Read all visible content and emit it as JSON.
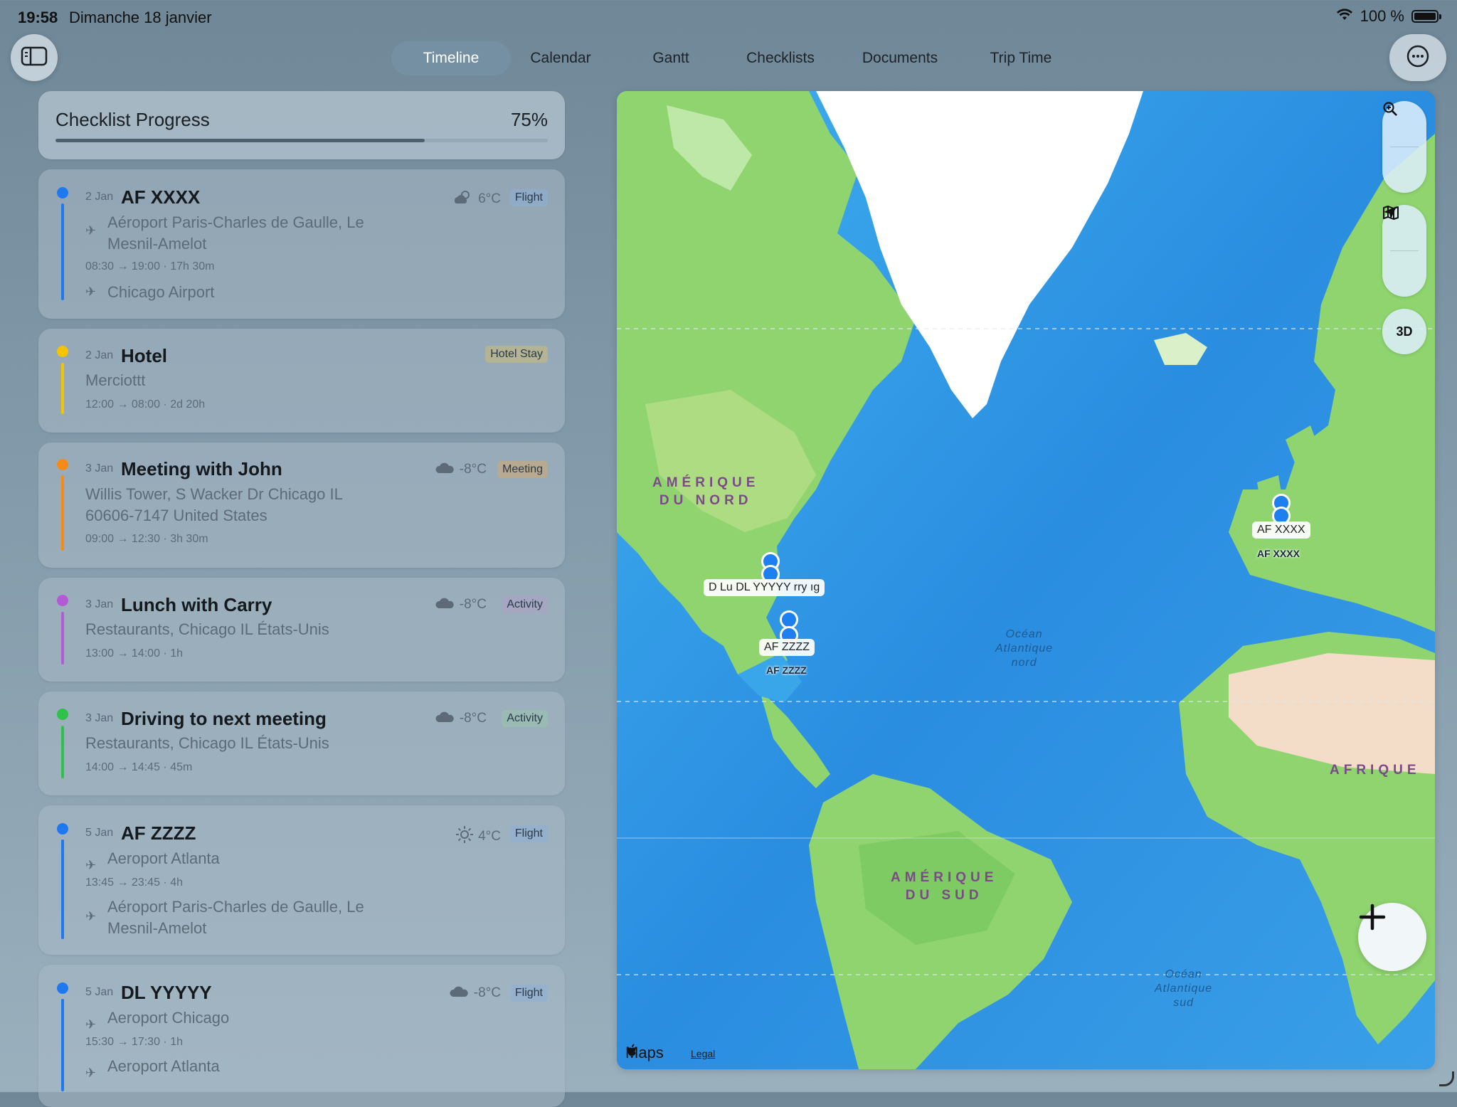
{
  "status_bar": {
    "time": "19:58",
    "date": "Dimanche 18 janvier",
    "battery": "100 %"
  },
  "tabs": [
    {
      "label": "Timeline",
      "active": true
    },
    {
      "label": "Calendar",
      "active": false
    },
    {
      "label": "Gantt",
      "active": false
    },
    {
      "label": "Checklists",
      "active": false
    },
    {
      "label": "Documents",
      "active": false
    },
    {
      "label": "Trip Time",
      "active": false
    }
  ],
  "checklist": {
    "title": "Checklist Progress",
    "percent_label": "75%",
    "progress": 0.75
  },
  "events": [
    {
      "date": "2 Jan",
      "title": "AF XXXX",
      "weather_icon": "cloud-sun-icon",
      "temp": "6°C",
      "badge": "Flight",
      "from_line1": "Aéroport Paris-Charles de Gaulle, Le",
      "from_line2": "Mesnil-Amelot",
      "times": "08:30 → 19:00 · 17h 30m",
      "to_line1": "Chicago Airport",
      "color": "#1e78f0"
    },
    {
      "date": "2 Jan",
      "title": "Hotel",
      "badge": "Hotel Stay",
      "place": "Merciottt",
      "times": "12:00 → 08:00 · 2d 20h",
      "color": "#f5c400"
    },
    {
      "date": "3 Jan",
      "title": "Meeting with John",
      "weather_icon": "cloud-icon",
      "temp": "-8°C",
      "badge": "Meeting",
      "place_line1": "Willis Tower, S Wacker Dr Chicago IL",
      "place_line2": "60606-7147 United States",
      "times": "09:00 → 12:30 · 3h 30m",
      "color": "#f58a16"
    },
    {
      "date": "3 Jan",
      "title": "Lunch with Carry",
      "weather_icon": "cloud-icon",
      "temp": "-8°C",
      "badge": "Activity",
      "place": "Restaurants, Chicago IL États-Unis",
      "times": "13:00 → 14:00 · 1h",
      "color": "#b45ad6"
    },
    {
      "date": "3 Jan",
      "title": "Driving to next meeting",
      "weather_icon": "cloud-icon",
      "temp": "-8°C",
      "badge": "Activity",
      "place": "Restaurants, Chicago IL États-Unis",
      "times": "14:00 → 14:45 · 45m",
      "color": "#2ec24a"
    },
    {
      "date": "5 Jan",
      "title": "AF ZZZZ",
      "weather_icon": "sun-icon",
      "temp": "4°C",
      "badge": "Flight",
      "from_line1": "Aeroport Atlanta",
      "times": "13:45 → 23:45 · 4h",
      "to_line1": "Aéroport Paris-Charles de Gaulle, Le",
      "to_line2": "Mesnil-Amelot",
      "color": "#1e78f0"
    },
    {
      "date": "5 Jan",
      "title": "DL YYYYY",
      "weather_icon": "cloud-icon",
      "temp": "-8°C",
      "badge": "Flight",
      "from_line1": "Aeroport Chicago",
      "times": "15:30 → 17:30 · 1h",
      "to_line1": "Aeroport Atlanta",
      "color": "#1e78f0"
    }
  ],
  "map": {
    "labels": {
      "north_america": "AMÉRIQUE\nDU NORD",
      "south_america": "AMÉRIQUE\nDU SUD",
      "africa": "AFRIQUE",
      "ocean_north": "Océan\nAtlantique\nnord",
      "ocean_south": "Océan\nAtlantique\nsud"
    },
    "pins": {
      "paris_label": "AF XXXX",
      "paris_sub": "AF XXXX",
      "chicago_label": "D  Lu DL YYYYY rry  ıg",
      "atlanta_label": "AF ZZZZ",
      "atlanta_sub": "AF ZZZZ"
    },
    "controls": {
      "three_d": "3D"
    },
    "attribution": "Maps",
    "legal": "Legal"
  }
}
